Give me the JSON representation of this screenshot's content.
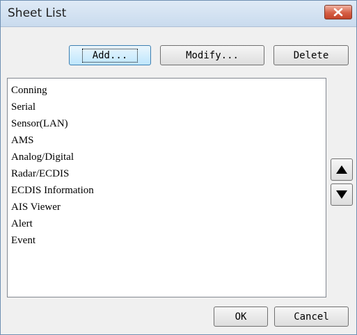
{
  "window": {
    "title": "Sheet List"
  },
  "toolbar": {
    "add_label": "Add...",
    "modify_label": "Modify...",
    "delete_label": "Delete"
  },
  "list": {
    "items": [
      "Conning",
      "Serial",
      "Sensor(LAN)",
      "AMS",
      "Analog/Digital",
      "Radar/ECDIS",
      "ECDIS Information",
      "AIS Viewer",
      "Alert",
      "Event"
    ]
  },
  "footer": {
    "ok_label": "OK",
    "cancel_label": "Cancel"
  },
  "icons": {
    "close": "close-icon",
    "up": "arrow-up-icon",
    "down": "arrow-down-icon"
  },
  "colors": {
    "close_button": "#c9543a",
    "title_bar": "#d4e3f3",
    "default_button": "#bee6fd"
  }
}
